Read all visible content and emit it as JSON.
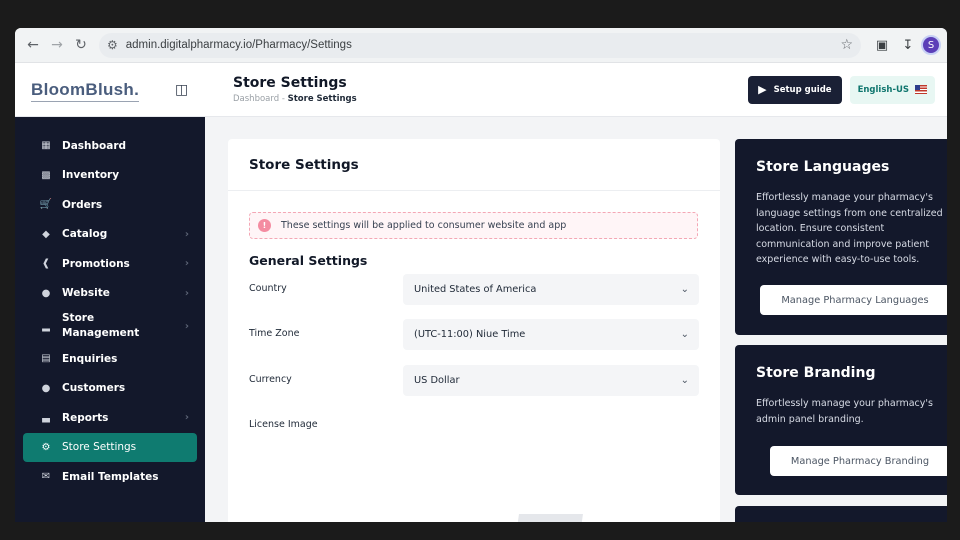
{
  "browser": {
    "url": "admin.digitalpharmacy.io/Pharmacy/Settings",
    "profile_initial": "S"
  },
  "header": {
    "logo": "BloomBlush.",
    "title": "Store Settings",
    "breadcrumb": {
      "root": "Dashboard",
      "separator": "-",
      "current": "Store Settings"
    },
    "setup_label": "Setup guide",
    "language_label": "English-US"
  },
  "sidebar": {
    "items": [
      {
        "label": "Dashboard",
        "icon": "dashboard-icon"
      },
      {
        "label": "Inventory",
        "icon": "inventory-icon"
      },
      {
        "label": "Orders",
        "icon": "cart-icon"
      },
      {
        "label": "Catalog",
        "icon": "tag-icon"
      },
      {
        "label": "Promotions",
        "icon": "promotions-icon"
      },
      {
        "label": "Website",
        "icon": "globe-icon"
      },
      {
        "label": "Store Management",
        "icon": "chart-icon"
      },
      {
        "label": "Enquiries",
        "icon": "clipboard-icon"
      },
      {
        "label": "Customers",
        "icon": "customers-icon"
      },
      {
        "label": "Reports",
        "icon": "reports-icon"
      },
      {
        "label": "Store Settings",
        "icon": "gear-icon"
      },
      {
        "label": "Email Templates",
        "icon": "mail-icon"
      }
    ]
  },
  "settings": {
    "card_title": "Store Settings",
    "alert": "These settings will be applied to consumer website and app",
    "section_title": "General Settings",
    "fields": {
      "country": {
        "label": "Country",
        "value": "United States of America"
      },
      "timezone": {
        "label": "Time Zone",
        "value": "(UTC-11:00) Niue Time"
      },
      "currency": {
        "label": "Currency",
        "value": "US Dollar"
      },
      "license": {
        "label": "License Image"
      }
    }
  },
  "panels": {
    "languages": {
      "title": "Store Languages",
      "description": "Effortlessly manage your pharmacy's language settings from one centralized location. Ensure consistent communication and improve patient experience with easy-to-use tools.",
      "button": "Manage Pharmacy Languages"
    },
    "branding": {
      "title": "Store Branding",
      "description": "Effortlessly manage your pharmacy's admin panel branding.",
      "button": "Manage Pharmacy Branding"
    }
  }
}
